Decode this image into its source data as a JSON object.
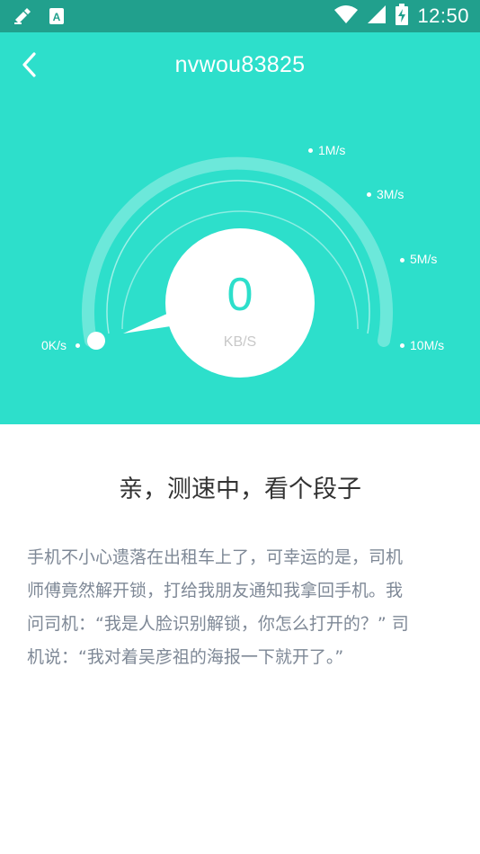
{
  "status_bar": {
    "time": "12:50",
    "icons": [
      "notification-icon",
      "app-store-icon",
      "wifi-icon",
      "signal-icon",
      "battery-charging-icon"
    ]
  },
  "header": {
    "title": "nvwou83825",
    "back_icon": "chevron-left-icon"
  },
  "gauge": {
    "value": "0",
    "unit": "KB/S",
    "scale_labels": [
      "0K/s",
      "1M/s",
      "3M/s",
      "5M/s",
      "10M/s"
    ],
    "level": 0
  },
  "joke": {
    "heading": "亲，测速中，看个段子",
    "lines": [
      "手机不小心遗落在出租车上了，可幸运的是，司机",
      "师傅竟然解开锁，打给我朋友通知我拿回手机。我",
      "问司机：“我是人脸识别解锁，你怎么打开的？” 司",
      "机说：“我对着吴彦祖的海报一下就开了。”"
    ]
  },
  "colors": {
    "accent": "#2ddfcb",
    "status_bar": "#21a08d",
    "body_text": "#7e8896",
    "heading_text": "#333333"
  }
}
